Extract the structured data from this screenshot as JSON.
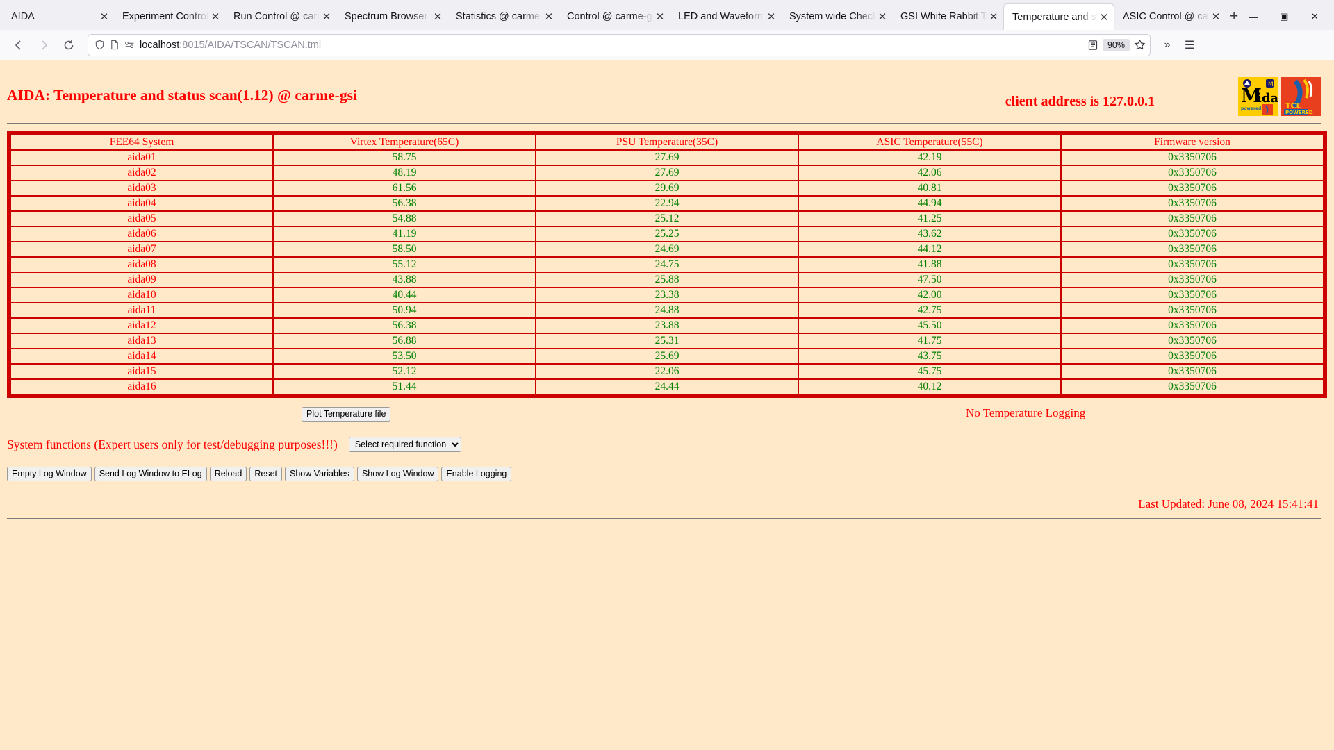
{
  "browser": {
    "tabs": [
      {
        "label": "AIDA",
        "active": false
      },
      {
        "label": "Experiment Control",
        "active": false
      },
      {
        "label": "Run Control @ carme-gsi",
        "active": false
      },
      {
        "label": "Spectrum Browser",
        "active": false
      },
      {
        "label": "Statistics @ carme-gsi",
        "active": false
      },
      {
        "label": "Control @ carme-gsi",
        "active": false
      },
      {
        "label": "LED and Waveform",
        "active": false
      },
      {
        "label": "System wide Check",
        "active": false
      },
      {
        "label": "GSI White Rabbit Time",
        "active": false
      },
      {
        "label": "Temperature and status scan",
        "active": true
      },
      {
        "label": "ASIC Control @ carme-gsi",
        "active": false
      }
    ],
    "new_tab_label": "+",
    "close_glyph": "✕",
    "window_controls": {
      "minimize": "—",
      "maximize": "▣",
      "close": "✕"
    },
    "nav": {
      "back": "←",
      "forward": "→",
      "reload": "↻"
    },
    "url": {
      "host": "localhost",
      "path": ":8015/AIDA/TSCAN/TSCAN.tml",
      "full": "localhost:8015/AIDA/TSCAN/TSCAN.tml"
    },
    "zoom_level": "90%",
    "icons": {
      "shield": "shield-icon",
      "page": "page-icon",
      "permissions": "permissions-icon",
      "reader": "reader-mode-icon",
      "bookmark": "☆",
      "overflow": "»",
      "menu": "☰"
    }
  },
  "page": {
    "title": "AIDA: Temperature and status scan(1.12) @ carme-gsi",
    "client_address": "client address is 127.0.0.1",
    "logo_midas_text": "Midas",
    "logo_midas_sub": "powered by",
    "logo_tcl_text": "TCL",
    "logo_tcl_sub": "POWERED",
    "table": {
      "headers": [
        "FEE64 System",
        "Virtex Temperature(65C)",
        "PSU Temperature(35C)",
        "ASIC Temperature(55C)",
        "Firmware version"
      ],
      "rows": [
        [
          "aida01",
          "58.75",
          "27.69",
          "42.19",
          "0x3350706"
        ],
        [
          "aida02",
          "48.19",
          "27.69",
          "42.06",
          "0x3350706"
        ],
        [
          "aida03",
          "61.56",
          "29.69",
          "40.81",
          "0x3350706"
        ],
        [
          "aida04",
          "56.38",
          "22.94",
          "44.94",
          "0x3350706"
        ],
        [
          "aida05",
          "54.88",
          "25.12",
          "41.25",
          "0x3350706"
        ],
        [
          "aida06",
          "41.19",
          "25.25",
          "43.62",
          "0x3350706"
        ],
        [
          "aida07",
          "58.50",
          "24.69",
          "44.12",
          "0x3350706"
        ],
        [
          "aida08",
          "55.12",
          "24.75",
          "41.88",
          "0x3350706"
        ],
        [
          "aida09",
          "43.88",
          "25.88",
          "47.50",
          "0x3350706"
        ],
        [
          "aida10",
          "40.44",
          "23.38",
          "42.00",
          "0x3350706"
        ],
        [
          "aida11",
          "50.94",
          "24.88",
          "42.75",
          "0x3350706"
        ],
        [
          "aida12",
          "56.38",
          "23.88",
          "45.50",
          "0x3350706"
        ],
        [
          "aida13",
          "56.88",
          "25.31",
          "41.75",
          "0x3350706"
        ],
        [
          "aida14",
          "53.50",
          "25.69",
          "43.75",
          "0x3350706"
        ],
        [
          "aida15",
          "52.12",
          "22.06",
          "45.75",
          "0x3350706"
        ],
        [
          "aida16",
          "51.44",
          "24.44",
          "40.12",
          "0x3350706"
        ]
      ]
    },
    "plot_button": "Plot Temperature file",
    "logging_status": "No Temperature Logging",
    "system_functions_label": "System functions (Expert users only for test/debugging purposes!!!)",
    "function_select_value": "Select required function",
    "function_select_options": [
      "Select required function"
    ],
    "action_buttons": [
      "Empty Log Window",
      "Send Log Window to ELog",
      "Reload",
      "Reset",
      "Show Variables",
      "Show Log Window",
      "Enable Logging"
    ],
    "last_updated": "Last Updated: June 08, 2024 15:41:41",
    "colors": {
      "background": "#ffe9c9",
      "accent_red": "#ff0000",
      "table_border": "#cc0000",
      "value_green": "#008000"
    }
  }
}
